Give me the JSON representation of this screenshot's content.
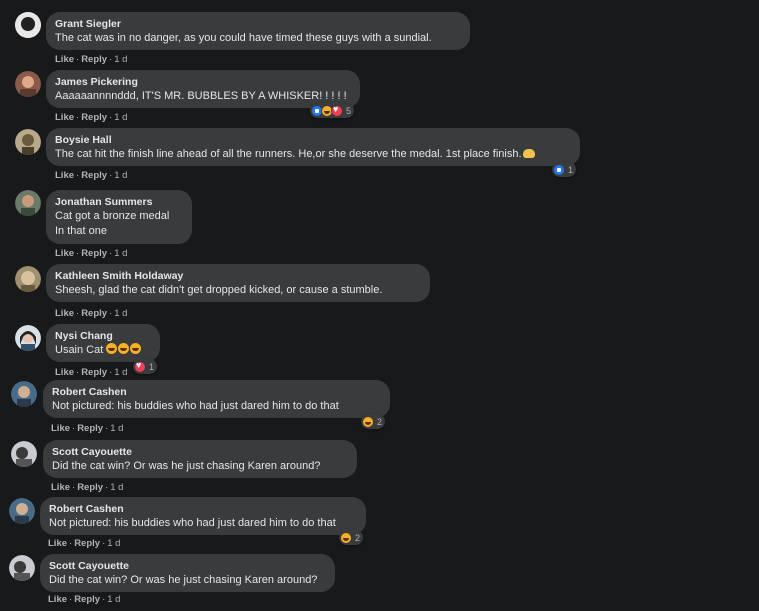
{
  "actions": {
    "like": "Like",
    "reply": "Reply",
    "sep": "·"
  },
  "comments": [
    {
      "author": "Grant Siegler",
      "lines": [
        "The cat was in no danger, as you could have timed these guys with a sundial."
      ],
      "time": "1 d"
    },
    {
      "author": "James Pickering",
      "lines": [
        "Aaaaaannnnddd, IT'S MR. BUBBLES BY A WHISKER! ! ! ! !"
      ],
      "time": "1 d",
      "reactions": {
        "icons": [
          "like-icon",
          "haha-icon",
          "love-icon"
        ],
        "count": "5"
      }
    },
    {
      "author": "Boysie Hall",
      "lines": [
        "The cat hit the finish line ahead of all the runners. He,or she deserve the medal. 1st place finish."
      ],
      "time": "1 d",
      "emoji_suffix": "raising-hands-emoji",
      "reactions": {
        "icons": [
          "like-icon"
        ],
        "count": "1"
      }
    },
    {
      "author": "Jonathan Summers",
      "lines": [
        "Cat got a bronze medal",
        "In that one"
      ],
      "time": "1 d"
    },
    {
      "author": "Kathleen Smith Holdaway",
      "lines": [
        "Sheesh, glad the cat didn't get dropped kicked, or cause a stumble."
      ],
      "time": "1 d"
    },
    {
      "author": "Nysi Chang",
      "lines": [
        "Usain Cat"
      ],
      "time": "1 d",
      "emoji_suffix": "laughing-emoji x3",
      "reactions": {
        "icons": [
          "love-icon"
        ],
        "count": "1"
      }
    },
    {
      "author": "Robert Cashen",
      "lines": [
        "Not pictured: his buddies who had just dared him to do that"
      ],
      "time": "1 d",
      "reactions": {
        "icons": [
          "haha-icon"
        ],
        "count": "2"
      }
    },
    {
      "author": "Scott Cayouette",
      "lines": [
        "Did the cat win? Or was he just chasing Karen around?"
      ],
      "time": "1 d"
    },
    {
      "author": "Robert Cashen",
      "lines": [
        "Not pictured: his buddies who had just dared him to do that"
      ],
      "time": "1 d",
      "reactions": {
        "icons": [
          "haha-icon"
        ],
        "count": "2"
      }
    },
    {
      "author": "Scott Cayouette",
      "lines": [
        "Did the cat win? Or was he just chasing Karen around?"
      ],
      "time": "1 d"
    }
  ]
}
